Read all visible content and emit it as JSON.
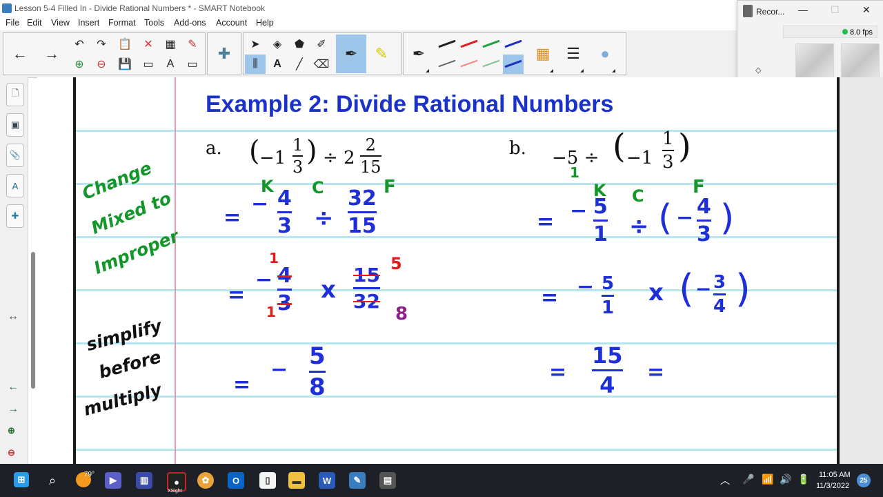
{
  "window": {
    "title": "Lesson 5-4 Filled In - Divide Rational Numbers * - SMART Notebook"
  },
  "menu": [
    "File",
    "Edit",
    "View",
    "Insert",
    "Format",
    "Tools",
    "Add-ons",
    "Account",
    "Help"
  ],
  "recorder": {
    "title": "Recor...",
    "fps": "8.0 fps"
  },
  "slide": {
    "title": "Example 2:  Divide Rational Numbers",
    "part_a": {
      "label": "a.",
      "expr_prefix": "(−1",
      "expr_num": "1",
      "expr_den": "3",
      "expr_mid": ") ÷ 2",
      "expr_num2": "2",
      "expr_den2": "15"
    },
    "part_b": {
      "label": "b.",
      "expr_prefix": "−5 ÷ (−1",
      "expr_num": "1",
      "expr_den": "3",
      "expr_close": ")"
    },
    "notes": {
      "kcf_k": "K",
      "kcf_c": "C",
      "kcf_f": "F",
      "mixed_1": "Change",
      "mixed_2": "Mixed to",
      "mixed_3": "Improper",
      "simplify_1": "simplify",
      "simplify_2": "before",
      "simplify_3": "multiply"
    },
    "work_a": {
      "line1": {
        "eq": "=",
        "sign": "−",
        "n1": "4",
        "d1": "3",
        "op": "÷",
        "n2": "32",
        "d2": "15"
      },
      "line2": {
        "eq": "=",
        "sign": "−",
        "n1": "4",
        "d1": "3",
        "op": "x",
        "n2": "15",
        "d2": "32",
        "r1": "1",
        "r2": "1",
        "r3": "5",
        "r4": "8"
      },
      "line3": {
        "eq": "=",
        "sign": "−",
        "n": "5",
        "d": "8"
      }
    },
    "work_b": {
      "line1": {
        "eq": "=",
        "sign": "−",
        "n1": "5",
        "d1": "1",
        "op": "÷",
        "n2": "4",
        "d2": "3",
        "paren_sign": "−",
        "one": "1"
      },
      "line2": {
        "eq": "=",
        "sign": "−",
        "n1": "5",
        "d1": "1",
        "op": "x",
        "n2": "3",
        "d2": "4",
        "paren_sign": "−"
      },
      "line3": {
        "eq": "=",
        "n": "15",
        "d": "4",
        "eq2": "="
      }
    }
  },
  "taskbar": {
    "weather": "79°",
    "time": "11:05 AM",
    "date": "11/3/2022",
    "badge": "25",
    "xsight": "XSight"
  }
}
